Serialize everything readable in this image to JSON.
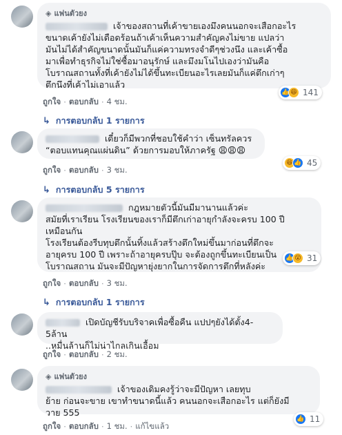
{
  "comments": [
    {
      "badge": "แฟนตัวยง",
      "text": "เจ้าของสถานที่เค้าขายเองมึงคนนอกจะเสือกอะไร\nขนาดเค้ายังไม่เดือดร้อนถ้าเค้าเห็นความสำคัญคงไม่ขาย แปลว่า\nมันไม่ได้สำคัญขนาดนั้นมันก็แค่ความทรงจำดีๆช่วงนึง และเค้าซื้อ\nมาเพื่อทำธุรกิจไม่ใช่ซื้อมาอนุรักษ์ และมึงมโนไปเองว่ามันคือ\nโบราณสถานทั้งที่เค้ายังไม่ได้ขึ้นทะเบียนอะไรเลยมันก็แค่ตึกเก่าๆ\nตึกนึงที่เค้าไม่เอาแล้ว",
      "like": "ถูกใจ",
      "reply": "ตอบกลับ",
      "time": "4 ชม.",
      "reaction_count": "141",
      "replies_label": "การตอบกลับ 1 รายการ"
    },
    {
      "text_inline": "เดี๋ยวก็มีพวกที่ชอบใช้คำว่า เซ็นทรัลควร\n“ตอบแทนคุณแผ่นดิน” ด้วยการมอบให้ภาครัฐ 😩😩😩",
      "like": "ถูกใจ",
      "reply": "ตอบกลับ",
      "time": "3 ชม.",
      "reaction_count": "45",
      "replies_label": "การตอบกลับ 5 รายการ"
    },
    {
      "text_inline": "กฎหมายตัวนี้มันมีมานานแล้วค่ะ\nสมัยที่เราเรียน โรงเรียนของเราก็มีตึกเก่าอายุกำลังจะครบ 100 ปี\nเหมือนกัน\nโรงเรียนต้องรีบทุบตึกนั้นทิ้งแล้วสร้างตึกใหม่ขึ้นมาก่อนที่ตึกจะ\nอายุครบ 100 ปี เพราะถ้าอายุครบปุ๊บ จะต้องถูกขึ้นทะเบียนเป็น\nโบราณสถาน มันจะมีปัญหายุ่งยากในการจัดการตึกที่หลังค่ะ",
      "like": "ถูกใจ",
      "reply": "ตอบกลับ",
      "time": "3 ชม.",
      "reaction_count": "31",
      "replies_label": "การตอบกลับ 1 รายการ"
    },
    {
      "text_inline": "เปิดบัญชีรับบริจาคเพื่อซื้อคืน แปปๆยังได้ตั้ง4-5ล้าน\n..หมื่นล้านก็ไม่น่าไกลเกินเอื้อม",
      "like": "ถูกใจ",
      "reply": "ตอบกลับ",
      "time": "2 ชม."
    },
    {
      "badge": "แฟนตัวยง",
      "text_inline": "เจ้าของเดิมคงรู้ว่าจะมีปัญหา เลยทุบ\nย้าย ก่อนจะขาย เขาทำขนาดนี้แล้ว คนนอกจะเสือกอะไร แต่ก็ยังมี\nวาย 555",
      "like": "ถูกใจ",
      "reply": "ตอบกลับ",
      "time": "1 ชม.",
      "edited": "แก้ไขแล้ว",
      "reaction_count": "11"
    }
  ]
}
